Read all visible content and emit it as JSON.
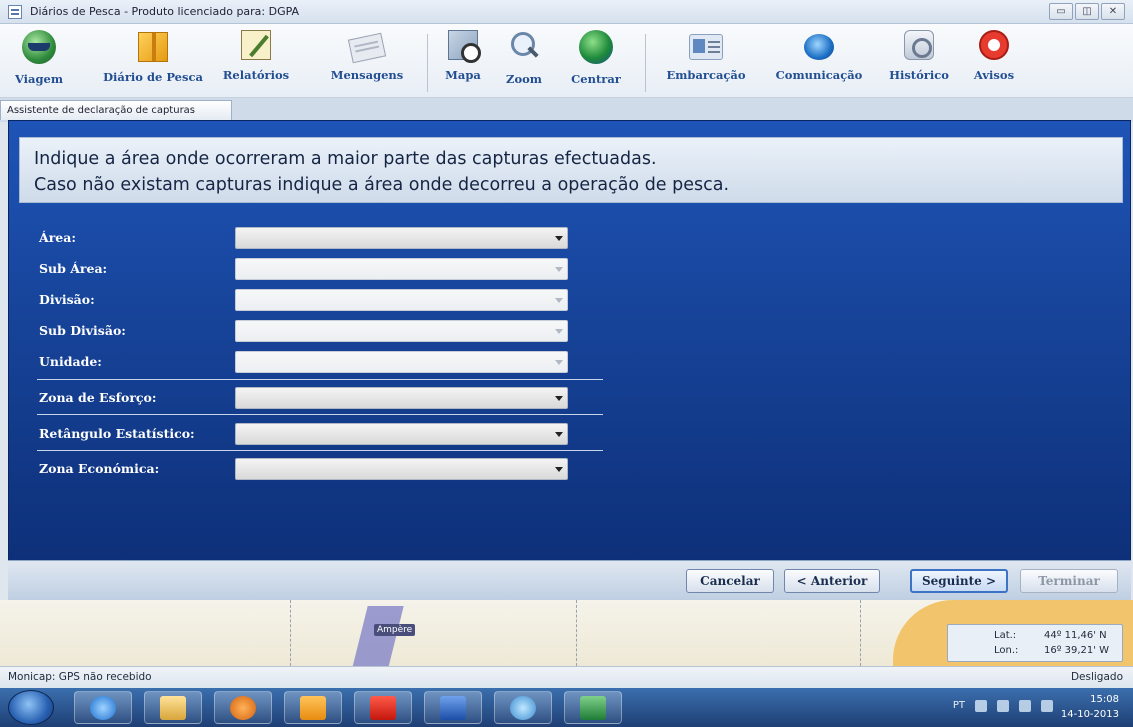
{
  "window": {
    "title": "Diários de Pesca - Produto licenciado para: DGPA",
    "controls": [
      "▭",
      "◫",
      "✕"
    ]
  },
  "toolbar": {
    "items": [
      {
        "label": "Viagem",
        "icon": "globe-boat-icon"
      },
      {
        "label": "Diário de Pesca",
        "icon": "box-icon"
      },
      {
        "label": "Relatórios",
        "icon": "report-icon"
      },
      {
        "label": "Mensagens",
        "icon": "message-icon"
      },
      {
        "label": "Mapa",
        "icon": "map-icon"
      },
      {
        "label": "Zoom",
        "icon": "magnifier-icon"
      },
      {
        "label": "Centrar",
        "icon": "center-globe-icon"
      },
      {
        "label": "Embarcação",
        "icon": "vessel-card-icon"
      },
      {
        "label": "Comunicação",
        "icon": "satellite-icon"
      },
      {
        "label": "Histórico",
        "icon": "history-icon"
      },
      {
        "label": "Avisos",
        "icon": "alarm-clock-icon"
      }
    ]
  },
  "wizard": {
    "tab_title": "Assistente de declaração de capturas",
    "instruction_line1": "Indique a área onde ocorreram a maior parte das capturas efectuadas.",
    "instruction_line2": "Caso não existam capturas indique a área onde decorreu a operação de pesca.",
    "fields": [
      {
        "label": "Área:",
        "value": "",
        "enabled": true
      },
      {
        "label": "Sub Área:",
        "value": "",
        "enabled": false
      },
      {
        "label": "Divisão:",
        "value": "",
        "enabled": false
      },
      {
        "label": "Sub Divisão:",
        "value": "",
        "enabled": false
      },
      {
        "label": "Unidade:",
        "value": "",
        "enabled": false
      },
      {
        "label": "Zona de Esforço:",
        "value": "",
        "enabled": true
      },
      {
        "label": "Retângulo Estatístico:",
        "value": "",
        "enabled": true
      },
      {
        "label": "Zona Económica:",
        "value": "",
        "enabled": true
      }
    ],
    "buttons": {
      "cancel": "Cancelar",
      "previous": "< Anterior",
      "next": "Seguinte >",
      "finish": "Terminar"
    }
  },
  "map": {
    "label": "Ampère",
    "lat_label": "Lat.:",
    "lat_value": "44º 11,46' N",
    "lon_label": "Lon.:",
    "lon_value": "16º 39,21' W"
  },
  "status": {
    "left": "Monicap: GPS não recebido",
    "right": "Desligado"
  },
  "taskbar": {
    "language": "PT",
    "time": "15:08",
    "date": "14-10-2013",
    "apps": [
      "internet-explorer",
      "file-explorer",
      "media-player",
      "outlook",
      "acrobat",
      "word",
      "network-app",
      "excel"
    ]
  },
  "colors": {
    "wizard_top": "#1e54b7",
    "wizard_bottom": "#0c2d74",
    "toolbar_label": "#234e92"
  }
}
